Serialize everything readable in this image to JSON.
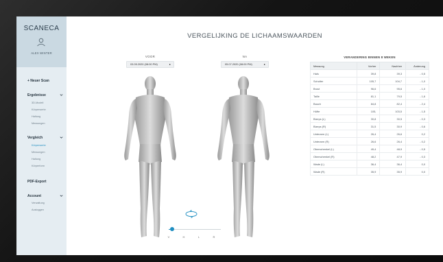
{
  "sidebar": {
    "brand": "SCANECA",
    "user_name": "ALEX WINTER",
    "new_scan": "+ Neuer Scan",
    "sections": [
      {
        "label": "Ergebnisse",
        "items": [
          "3D-Modell",
          "Körperwerte",
          "Haltung",
          "Messungen"
        ]
      },
      {
        "label": "Vergleich",
        "items": [
          "Körperwerte",
          "Messungen",
          "Haltung",
          "Körperform"
        ],
        "active_item": "Körperwerte"
      },
      {
        "label": "PDF-Export",
        "items": []
      },
      {
        "label": "Account",
        "items": [
          "Verwaltung",
          "Ausloggen"
        ]
      }
    ]
  },
  "main": {
    "title": "VERGELIJKING DE LICHAAMSWAARDEN",
    "before": {
      "label": "VOOR",
      "date": "03.05.2020 (08:00 PM)"
    },
    "after": {
      "label": "NA",
      "date": "05.07.2020 (08:00 PM)"
    },
    "slider_value": 0.07,
    "view_buttons": [
      "V",
      "H",
      "L",
      "R"
    ]
  },
  "table": {
    "title": "VERANDERING BINNEN 8 WEKEN",
    "headers": [
      "Messung",
      "Vorher",
      "Nachher",
      "Änderung"
    ],
    "rows": [
      [
        "Hals",
        "39,8",
        "39,3",
        "- 0,5"
      ],
      [
        "Schulter",
        "105,7",
        "104,7",
        "- 1,0"
      ],
      [
        "Brust",
        "96,6",
        "95,6",
        "- 1,0"
      ],
      [
        "Taille",
        "81,1",
        "79,5",
        "- 1,6"
      ],
      [
        "Bauch",
        "84,8",
        "82,4",
        "- 2,4"
      ],
      [
        "Hüfte",
        "105,",
        "103,5",
        "- 1,5"
      ],
      [
        "Bizeps (L)",
        "30,8",
        "30,5",
        "- 0,3"
      ],
      [
        "Bizeps (R)",
        "31,5",
        "30,9",
        "- 0,6"
      ],
      [
        "Unterarm (L)",
        "26,4",
        "26,6",
        "0,2"
      ],
      [
        "Unterarm (R)",
        "26,6",
        "26,4",
        "- 0,2"
      ],
      [
        "Oberschenkel (L)",
        "49,4",
        "48,9",
        "- 0,5"
      ],
      [
        "Oberschenkel (R)",
        "48,2",
        "47,9",
        "- 0,3"
      ],
      [
        "Wade (L)",
        "36,4",
        "36,4",
        "0,0"
      ],
      [
        "Wade (R)",
        "35,9",
        "35,9",
        "0,0"
      ]
    ]
  },
  "colors": {
    "accent": "#1f8ec1",
    "sidebar_bg": "#e5edf2",
    "sidebar_head_bg": "#cad9e2"
  }
}
